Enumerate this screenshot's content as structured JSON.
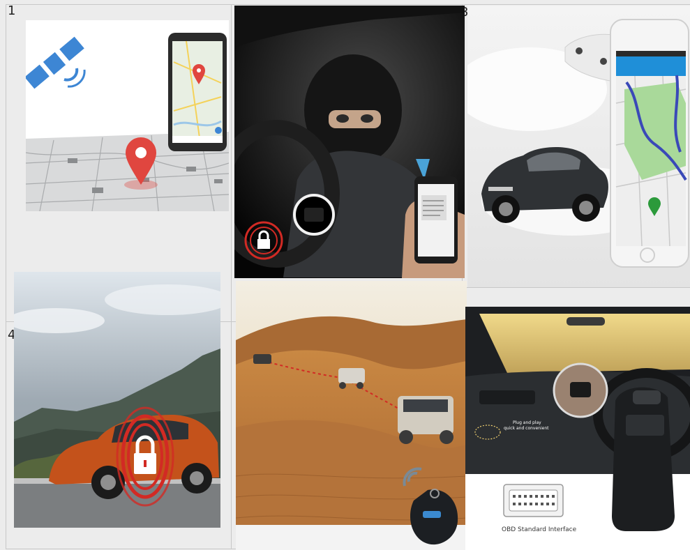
{
  "cells": [
    {
      "number": "1"
    },
    {
      "number": "3"
    },
    {
      "number": "4"
    }
  ],
  "tiles": {
    "gps_map": {
      "icons": [
        "satellite-icon",
        "location-pin-icon",
        "smartphone-icon"
      ]
    },
    "car_thief": {
      "icons": [
        "padlock-icon",
        "smartphone-icon"
      ]
    },
    "car_tracking_app": {
      "icons": [
        "smartphone-icon",
        "location-pin-icon"
      ]
    },
    "car_lock": {
      "icons": [
        "padlock-icon"
      ]
    },
    "desert_tracking": {
      "icons": [
        "signal-icon",
        "key-fob-tracker-icon"
      ]
    },
    "obd_device": {
      "caption_interface": "OBD Standard Interface",
      "caption_plug_line1": "Plug and play",
      "caption_plug_line2": "quick and convenient"
    }
  },
  "colors": {
    "pin_red": "#e0463f",
    "satellite_blue": "#3d86d4",
    "lock_red": "#d22a24",
    "desert_sand": "#c98843",
    "app_blue": "#1f8fd8"
  }
}
